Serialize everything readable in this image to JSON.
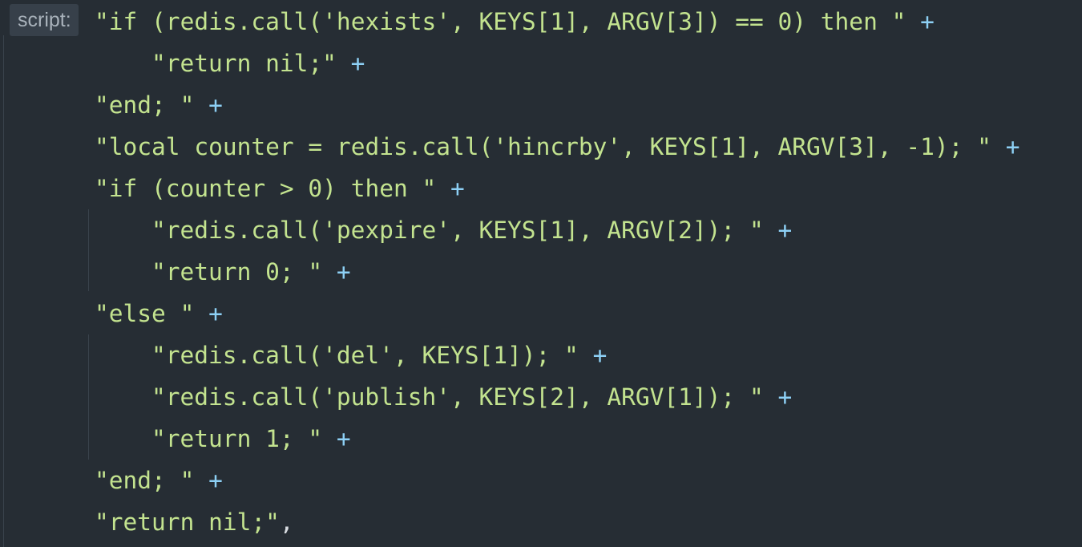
{
  "editor": {
    "param_hint": "script:",
    "lines": [
      {
        "text": "\"if (redis.call('hexists', KEYS[1], ARGV[3]) == 0) then \"",
        "op": "+",
        "indent": 0
      },
      {
        "text": "\"return nil;\"",
        "op": "+",
        "indent": 1
      },
      {
        "text": "\"end; \"",
        "op": "+",
        "indent": 0
      },
      {
        "text": "\"local counter = redis.call('hincrby', KEYS[1], ARGV[3], -1); \"",
        "op": "+",
        "indent": 0
      },
      {
        "text": "\"if (counter > 0) then \"",
        "op": "+",
        "indent": 0
      },
      {
        "text": "\"redis.call('pexpire', KEYS[1], ARGV[2]); \"",
        "op": "+",
        "indent": 1
      },
      {
        "text": "\"return 0; \"",
        "op": "+",
        "indent": 1
      },
      {
        "text": "\"else \"",
        "op": "+",
        "indent": 0
      },
      {
        "text": "\"redis.call('del', KEYS[1]); \"",
        "op": "+",
        "indent": 1
      },
      {
        "text": "\"redis.call('publish', KEYS[2], ARGV[1]); \"",
        "op": "+",
        "indent": 1
      },
      {
        "text": "\"return 1; \"",
        "op": "+",
        "indent": 1
      },
      {
        "text": "\"end; \"",
        "op": "+",
        "indent": 0
      },
      {
        "text": "\"return nil;\"",
        "op": ",",
        "indent": 0
      }
    ]
  },
  "colors": {
    "background": "#262d34",
    "string": "#c3e38f",
    "operator": "#8dd0f5",
    "hint_bg": "#37404a",
    "hint_text": "#a9b2bb"
  }
}
